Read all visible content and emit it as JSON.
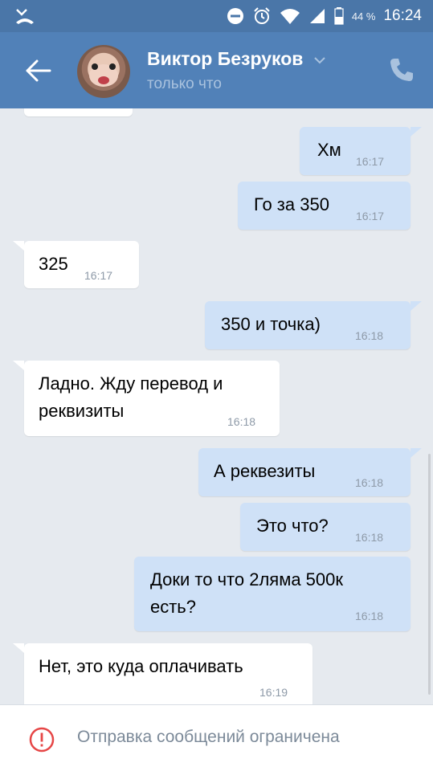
{
  "status_bar": {
    "battery_percent": "44 %",
    "time": "16:24",
    "icons": [
      "missed-call-icon",
      "do-not-disturb-icon",
      "alarm-icon",
      "wifi-icon",
      "signal-icon",
      "battery-icon"
    ]
  },
  "header": {
    "contact_name": "Виктор Безруков",
    "status": "только что",
    "accent_color": "#5181b8"
  },
  "messages": [
    {
      "dir": "out",
      "text": "Хм",
      "time": "16:17"
    },
    {
      "dir": "out",
      "text": "Го за 350",
      "time": "16:17"
    },
    {
      "dir": "in",
      "text": "325",
      "time": "16:17"
    },
    {
      "dir": "out",
      "text": "350 и точка)",
      "time": "16:18"
    },
    {
      "dir": "in",
      "text_lines": [
        "Ладно. Жду перевод и",
        "реквизиты"
      ],
      "time": "16:18"
    },
    {
      "dir": "out",
      "text": "А реквезиты",
      "time": "16:18"
    },
    {
      "dir": "out",
      "text": "Это что?",
      "time": "16:18"
    },
    {
      "dir": "out",
      "text_lines": [
        "Доки то что 2ляма 500к",
        "есть?"
      ],
      "time": "16:18"
    },
    {
      "dir": "in",
      "text": "Нет, это куда оплачивать",
      "time": "16:19"
    }
  ],
  "composer": {
    "restriction_text": "Отправка сообщений ограничена",
    "warning_color": "#e64646"
  }
}
